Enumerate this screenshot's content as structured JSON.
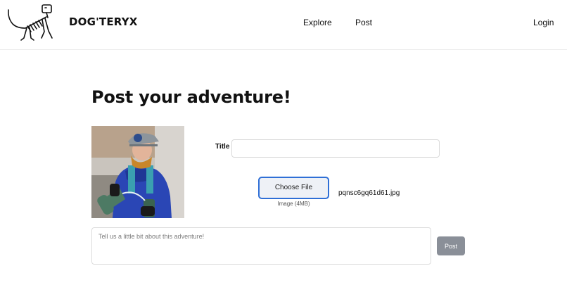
{
  "header": {
    "brand": "DOG'TERYX",
    "logo_icon": "dog-skeleton-logo-icon",
    "nav": {
      "explore": "Explore",
      "post": "Post",
      "login": "Login"
    }
  },
  "main": {
    "title": "Post your adventure!",
    "form": {
      "title_label": "Title",
      "title_value": "",
      "file_button_label": "Choose File",
      "file_hint": "Image (4MB)",
      "file_name": "pqnsc6gq61d61.jpg",
      "description_placeholder": "Tell us a little bit about this adventure!",
      "description_value": "",
      "submit_label": "Post"
    }
  },
  "colors": {
    "focus_border": "#2f6fd6",
    "submit_bg": "#8a8f98",
    "text": "#111111"
  }
}
